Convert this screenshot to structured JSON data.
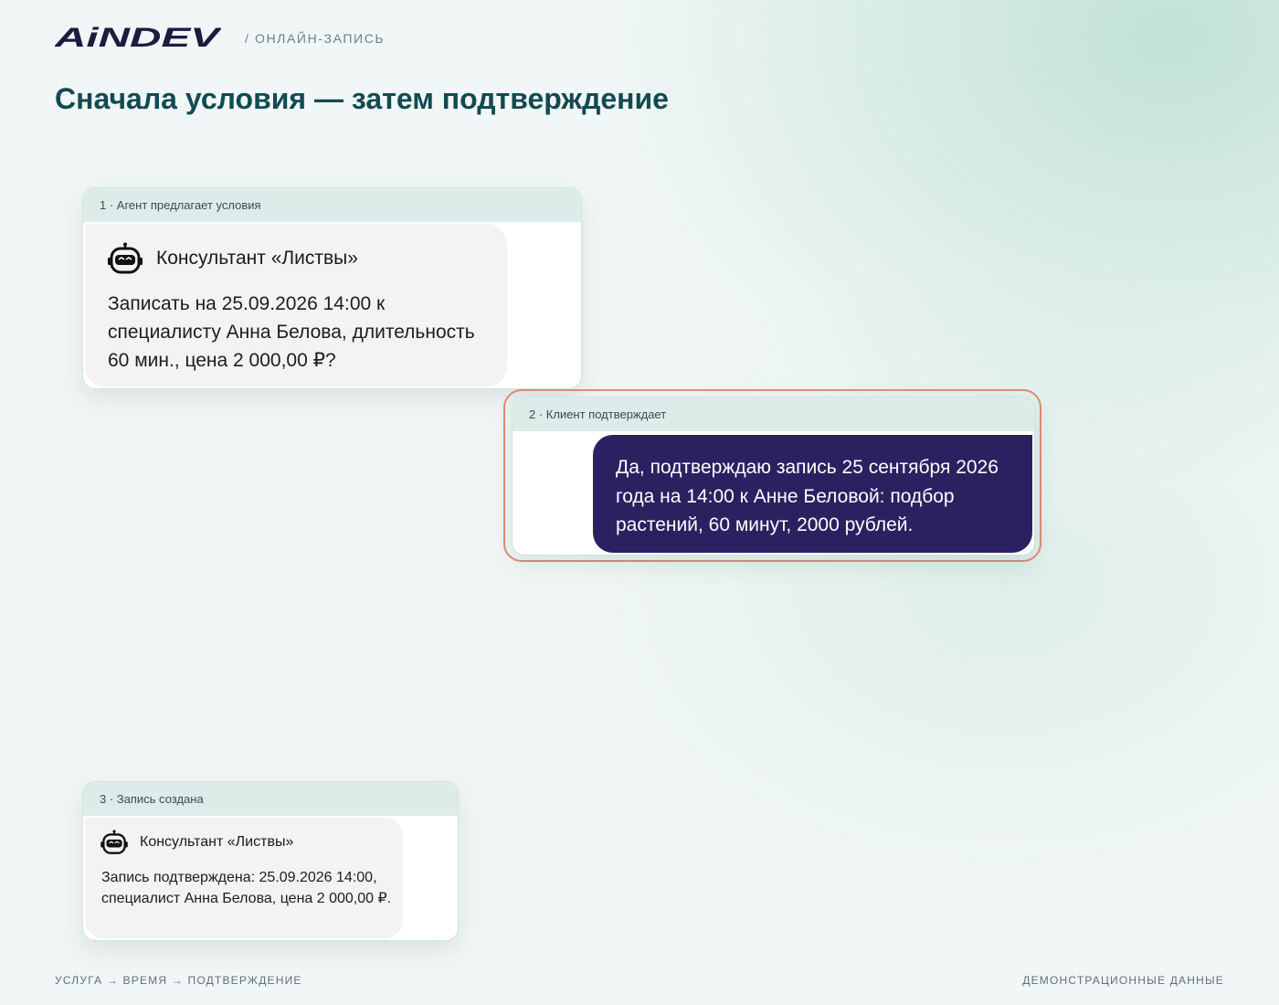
{
  "brand": {
    "logo_text": "AiNDEV"
  },
  "header": {
    "section_label": "/ ОНЛАЙН-ЗАПИСЬ",
    "title": "Сначала условия — затем подтверждение"
  },
  "steps": [
    {
      "label": "1 · Агент предлагает условия",
      "sender": "Консультант «Листвы»",
      "icon": "robot-icon",
      "message": "Записать на 25.09.2026 14:00 к специалисту Анна Белова, длительность 60 мин., цена 2 000,00 ₽?"
    },
    {
      "label": "2 · Клиент подтверждает",
      "message": "Да, подтверждаю запись 25 сентября 2026 года на 14:00 к Анне Беловой: подбор растений, 60 минут, 2000 рублей."
    },
    {
      "label": "3 · Запись создана",
      "sender": "Консультант «Листвы»",
      "icon": "robot-icon",
      "message": "Запись подтверждена: 25.09.2026 14:00, специалист Анна Белова, цена 2 000,00 ₽."
    }
  ],
  "footer": {
    "left": "УСЛУГА → ВРЕМЯ → ПОДТВЕРЖДЕНИЕ",
    "right": "ДЕМОНСТРАЦИОННЫЕ ДАННЫЕ"
  },
  "colors": {
    "title": "#134a52",
    "card_header_bg": "#deece9",
    "user_bubble": "#2b2161",
    "highlight_border": "#e08c78",
    "logo_gradient_start": "#8a78e0",
    "logo_gradient_end": "#3b2d8c"
  }
}
